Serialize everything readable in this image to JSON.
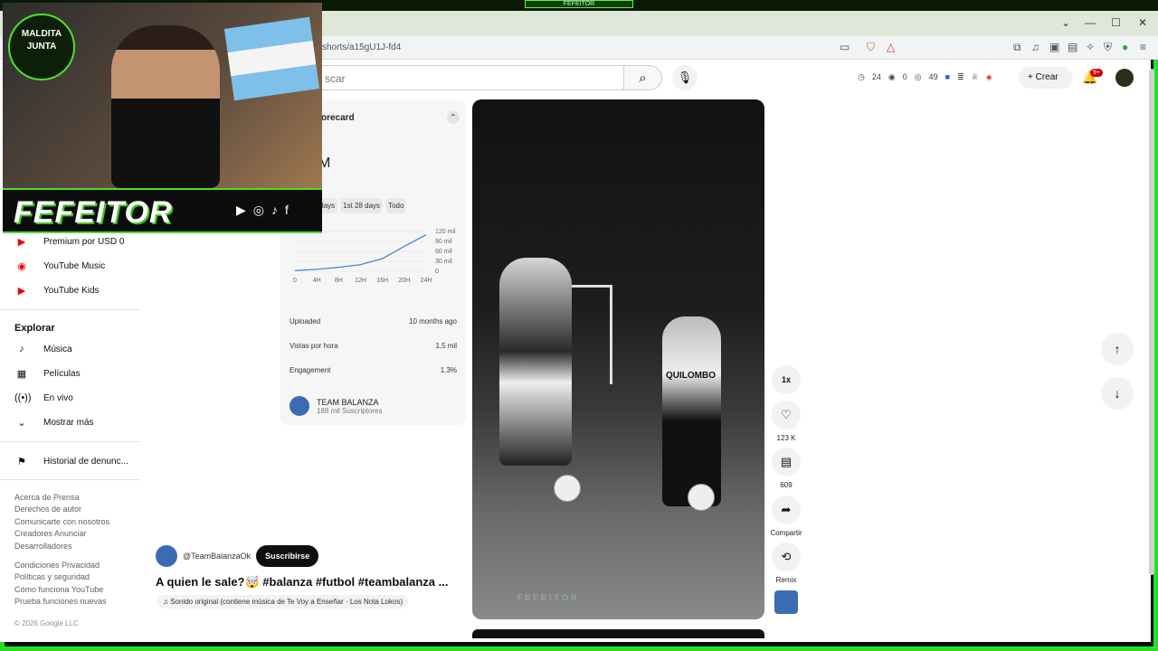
{
  "overlay": {
    "top_tag": "FEFEITOR",
    "logo_text_1": "MALDITA",
    "logo_text_2": "JUNTA",
    "streamer_name": "FEFEITOR",
    "social_icons": [
      "youtube-icon",
      "instagram-icon",
      "tiktok-icon",
      "facebook-icon"
    ]
  },
  "browser": {
    "url": "shorts/a15gU1J-fd4",
    "window_controls": [
      "⌄",
      "—",
      "☐",
      "✕"
    ]
  },
  "header": {
    "search_placeholder": "scar",
    "stats": [
      "24",
      "0",
      "49"
    ],
    "create_label": "Crear",
    "notif_badge": "9+"
  },
  "sidebar": {
    "items_top": [
      {
        "label": "Premium por USD 0",
        "icon": "youtube-premium-icon"
      },
      {
        "label": "YouTube Music",
        "icon": "youtube-music-icon"
      },
      {
        "label": "YouTube Kids",
        "icon": "youtube-kids-icon"
      }
    ],
    "explore_title": "Explorar",
    "explore_items": [
      {
        "label": "Música",
        "icon": "music-note-icon"
      },
      {
        "label": "Películas",
        "icon": "film-icon"
      },
      {
        "label": "En vivo",
        "icon": "live-icon"
      },
      {
        "label": "Mostrar más",
        "icon": "chevron-down-icon"
      }
    ],
    "history_label": "Historial de denunc...",
    "footer_lines": [
      "Acerca de  Prensa",
      "Derechos de autor",
      "Comunicarte con nosotros",
      "Creadores  Anunciar",
      "Desarrolladores",
      "Condiciones  Privacidad",
      "Políticas y seguridad",
      "Cómo funciona YouTube",
      "Prueba funciones nuevas"
    ],
    "copyright": "© 2026 Google LLC"
  },
  "scorecard": {
    "title": "orecard",
    "big_value": "M",
    "filters": [
      "rs",
      "1st 7 days",
      "1st 28 days",
      "Todo"
    ],
    "chart_data": {
      "type": "line",
      "x": [
        "0",
        "4H",
        "8H",
        "12H",
        "16H",
        "20H",
        "24H"
      ],
      "y_ticks": [
        "120 mil",
        "90 mil",
        "60 mil",
        "30 mil",
        "0"
      ],
      "values": [
        2000,
        6000,
        12000,
        20000,
        38000,
        75000,
        110000
      ],
      "ylim": [
        0,
        120000
      ]
    },
    "rows": [
      {
        "label": "Uploaded",
        "value": "10 months ago"
      },
      {
        "label": "Vistas por hora",
        "value": "1,5 mil"
      },
      {
        "label": "Engagement",
        "value": "1.3%"
      }
    ],
    "channel_name": "TEAM BALANZA",
    "channel_subs": "188 mil Suscriptores"
  },
  "video": {
    "jersey_text": "QUILOMBO",
    "speed": "1x",
    "likes": "123 K",
    "comments": "609",
    "share_label": "Compartir",
    "remix_label": "Remix",
    "channel_handle": "@TeamBalanzaOk",
    "subscribe_label": "Suscribirse",
    "title": "A quien le sale?🤯 #balanza #futbol #teambalanza ...",
    "sound": "♫ Sonido original (contiene música de Te Voy a Enseñar · Los Nota Lokos)",
    "bottom_overlay": "FEFEITOR"
  }
}
